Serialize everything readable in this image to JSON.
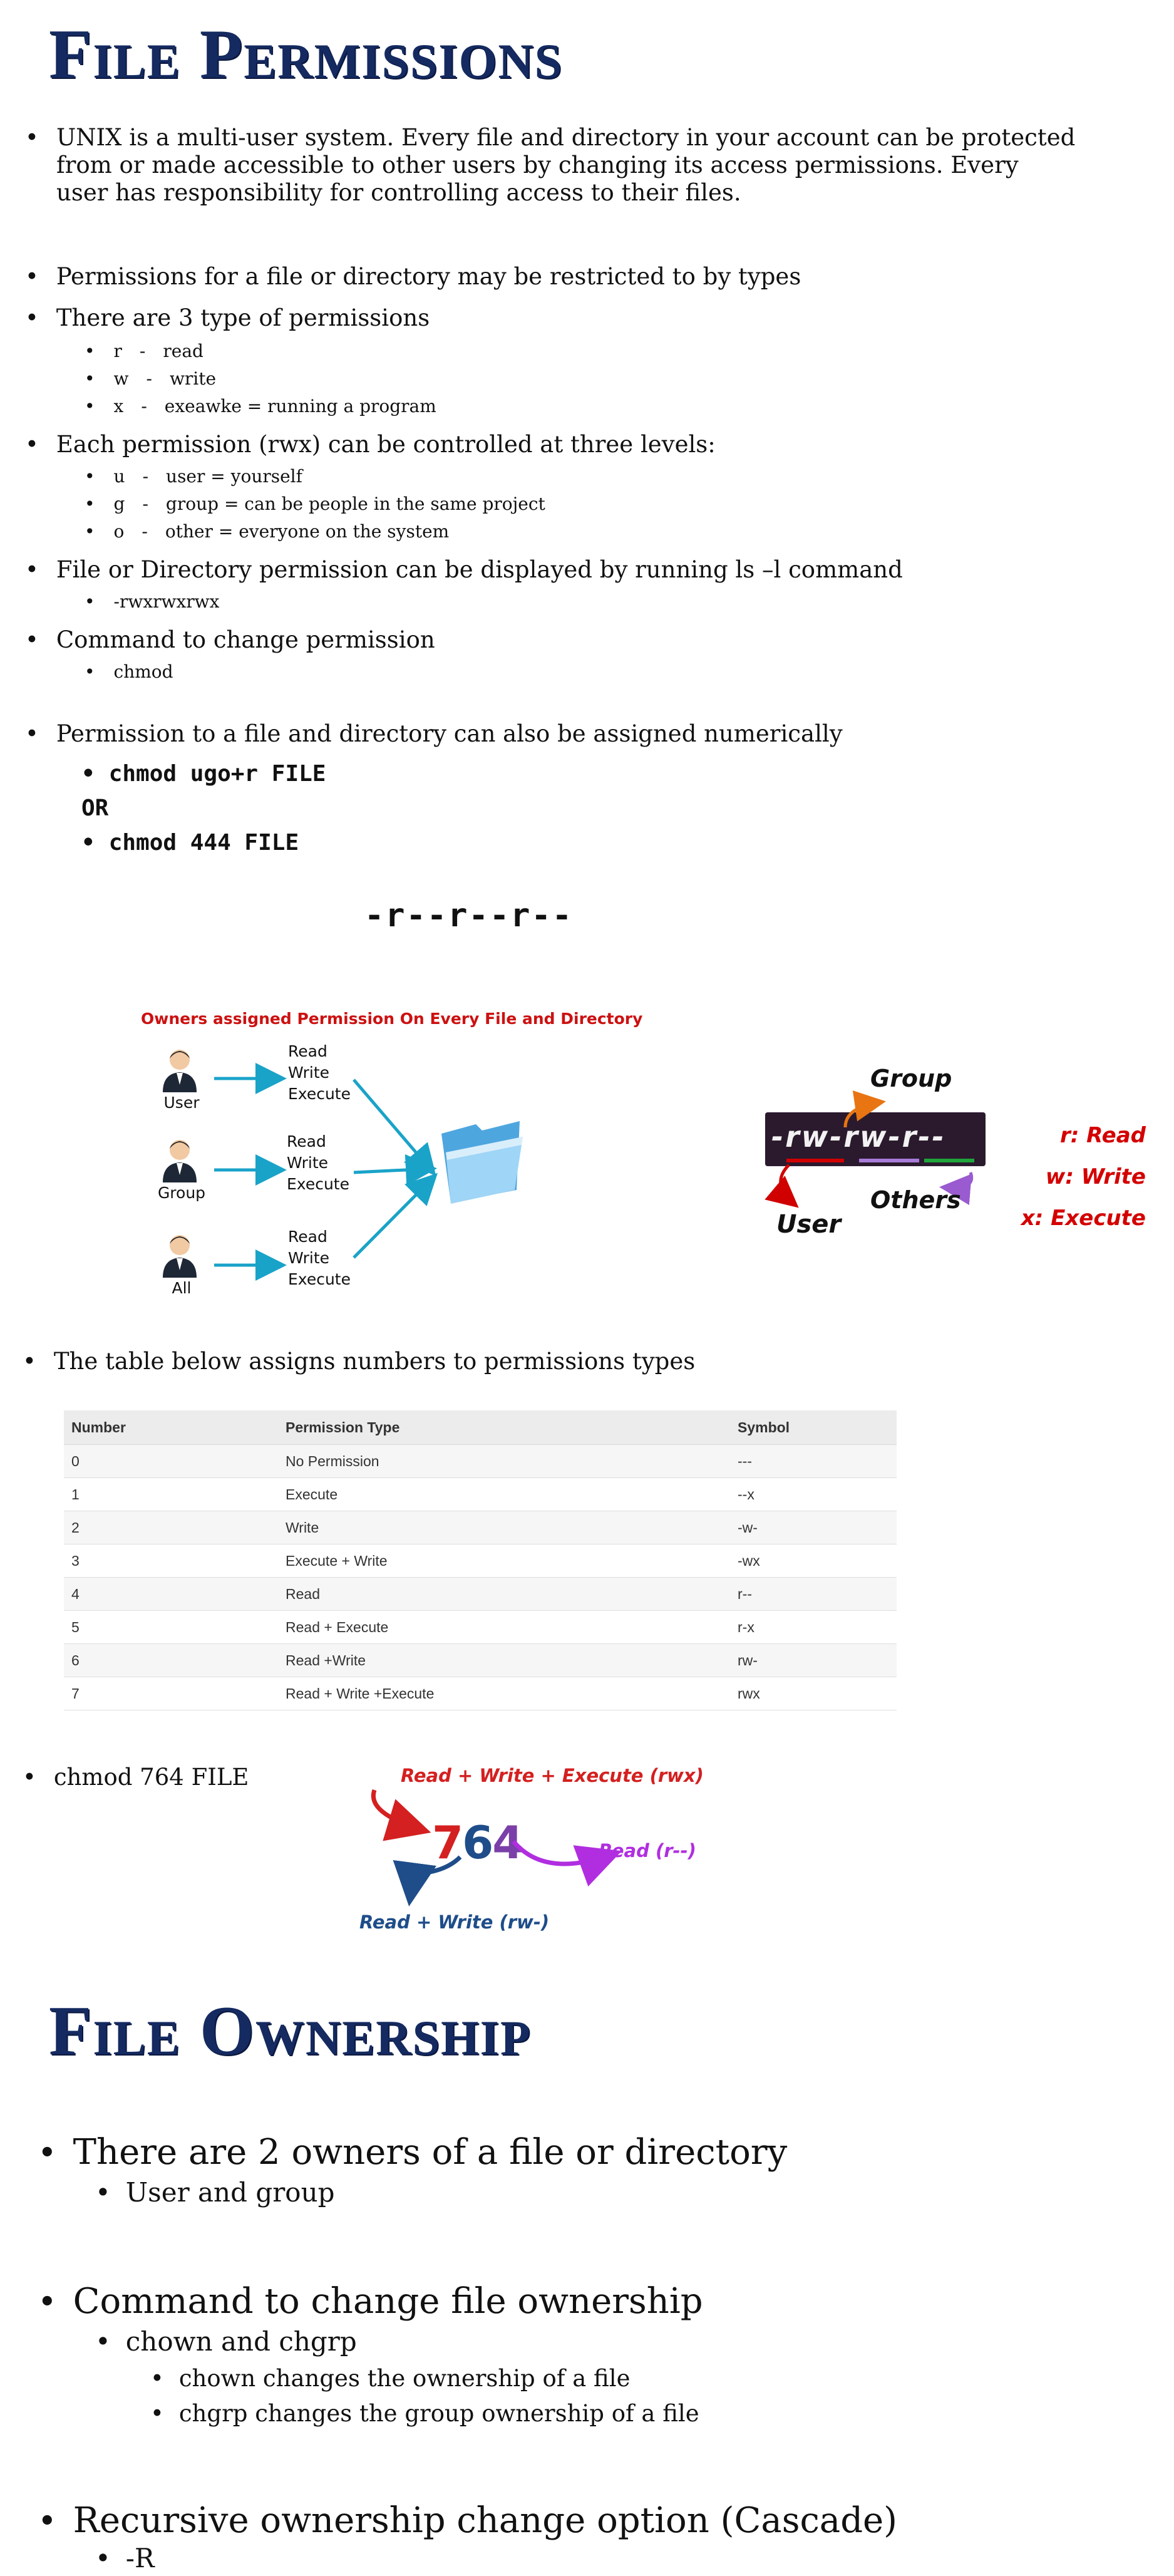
{
  "permissions": {
    "title": "File Permissions",
    "intro": "UNIX is a multi-user system. Every file and directory in your account can be protected from or made accessible to other users by changing its access permissions. Every user has responsibility for controlling access to their files.",
    "restricted": "Permissions for a file or directory may be restricted to by types",
    "types_heading": "There are 3 type of permissions",
    "types": [
      {
        "letter": "r",
        "sep": "-",
        "desc": "read"
      },
      {
        "letter": "w",
        "sep": "-",
        "desc": "write"
      },
      {
        "letter": "x",
        "sep": "-",
        "desc": "exeawke = running a program"
      }
    ],
    "levels_heading": "Each permission (rwx) can be controlled at three levels:",
    "levels": [
      {
        "letter": "u",
        "sep": "-",
        "desc": "user = yourself"
      },
      {
        "letter": "g",
        "sep": "-",
        "desc": "group = can be people in the same project"
      },
      {
        "letter": "o",
        "sep": "-",
        "desc": "other = everyone on the system"
      }
    ],
    "display_heading": "File or Directory permission can be displayed by running ls –l command",
    "display_example": "-rwxrwxrwx",
    "change_heading": "Command to change permission",
    "change_cmd": "chmod",
    "numeric_heading": "Permission to a file and directory can also be assigned numerically",
    "numeric_cmd1": "chmod ugo+r FILE",
    "or_label": "OR",
    "numeric_cmd2": "chmod 444 FILE",
    "result_string": "-r--r--r--"
  },
  "owners_diagram": {
    "caption": "Owners assigned Permission  On Every File and Directory",
    "rows": [
      {
        "who": "User",
        "perms": [
          "Read",
          "Write",
          "Execute"
        ]
      },
      {
        "who": "Group",
        "perms": [
          "Read",
          "Write",
          "Execute"
        ]
      },
      {
        "who": "All",
        "perms": [
          "Read",
          "Write",
          "Execute"
        ]
      }
    ],
    "colors": {
      "caption": "#cc1111",
      "arrow": "#1aa3c8",
      "folder": "#58b6ea"
    }
  },
  "rwx_diagram": {
    "string_parts": [
      "-",
      "rw",
      "-",
      "rw",
      "-",
      "r",
      "-",
      "-"
    ],
    "group_label": "Group",
    "others_label": "Others",
    "user_label": "User",
    "legend": [
      "r: Read",
      "w: Write",
      "x: Execute"
    ],
    "colors": {
      "box": "#2b1a2e",
      "legend": "#d40000",
      "group_arrow": "#e87511",
      "user_arrow": "#d00000",
      "others_arrow": "#9a5ad0"
    }
  },
  "numbers_table": {
    "intro": "The table below assigns numbers to permissions types",
    "headers": [
      "Number",
      "Permission Type",
      "Symbol"
    ],
    "rows": [
      [
        "0",
        "No Permission",
        "---"
      ],
      [
        "1",
        "Execute",
        "--x"
      ],
      [
        "2",
        "Write",
        "-w-"
      ],
      [
        "3",
        "Execute + Write",
        "-wx"
      ],
      [
        "4",
        "Read",
        "r--"
      ],
      [
        "5",
        "Read + Execute",
        "r-x"
      ],
      [
        "6",
        "Read +Write",
        "rw-"
      ],
      [
        "7",
        "Read + Write +Execute",
        "rwx"
      ]
    ]
  },
  "chmod764": {
    "label": "chmod 764 FILE",
    "digits": [
      "7",
      "6",
      "4"
    ],
    "top": "Read + Write + Execute (rwx)",
    "right": "Read (r--)",
    "bottom": "Read + Write (rw-)",
    "colors": {
      "seven": "#d42020",
      "six": "#1e4d8a",
      "four": "#7a3fa8",
      "purple": "#b02ee0"
    }
  },
  "ownership": {
    "title": "File Ownership",
    "owners_heading": "There are 2 owners of a file or directory",
    "owners_sub": "User  and group",
    "change_heading": "Command to change file ownership",
    "change_sub": "chown and chgrp",
    "chown_desc": "chown changes the ownership of a file",
    "chgrp_desc": "chgrp changes the group ownership of a file",
    "recursive_heading": "Recursive ownership change option (Cascade)",
    "recursive_flag": "-R"
  }
}
